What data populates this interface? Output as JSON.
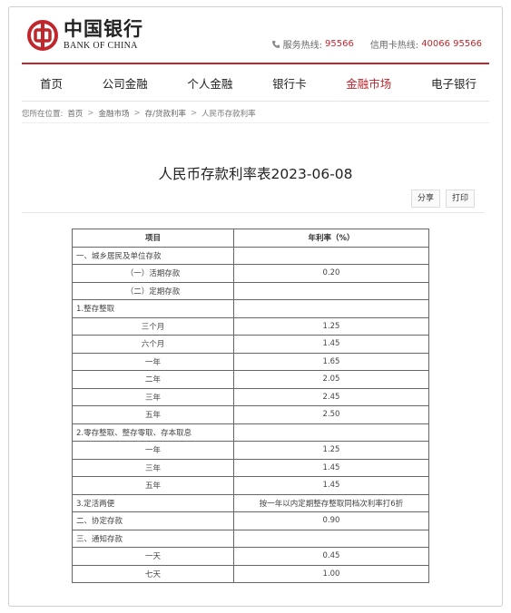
{
  "header": {
    "logo_cn": "中国银行",
    "logo_en": "BANK OF CHINA",
    "service_label": "服务热线:",
    "service_number": "95566",
    "card_label": "信用卡热线:",
    "card_number": "40066 95566",
    "accent_color": "#c0272d"
  },
  "nav": [
    "首页",
    "公司金融",
    "个人金融",
    "银行卡",
    "金融市场",
    "电子银行"
  ],
  "nav_active": "金融市场",
  "breadcrumb": {
    "prefix": "您所在位置:",
    "items": [
      "首页",
      "金融市场",
      "存/贷款利率",
      "人民币存款利率"
    ]
  },
  "page_title": "人民币存款利率表2023-06-08",
  "tools": {
    "share": "分享",
    "print": "打印"
  },
  "table": {
    "headers": [
      "项目",
      "年利率（%）"
    ],
    "rows": [
      {
        "item": "一、城乡居民及单位存款",
        "rate": "",
        "align": "left"
      },
      {
        "item": "（一）活期存款",
        "rate": "0.20",
        "align": "center"
      },
      {
        "item": "（二）定期存款",
        "rate": "",
        "align": "center"
      },
      {
        "item": "1.整存整取",
        "rate": "",
        "align": "left"
      },
      {
        "item": "三个月",
        "rate": "1.25",
        "align": "center"
      },
      {
        "item": "六个月",
        "rate": "1.45",
        "align": "center"
      },
      {
        "item": "一年",
        "rate": "1.65",
        "align": "center"
      },
      {
        "item": "二年",
        "rate": "2.05",
        "align": "center"
      },
      {
        "item": "三年",
        "rate": "2.45",
        "align": "center"
      },
      {
        "item": "五年",
        "rate": "2.50",
        "align": "center"
      },
      {
        "item": "2.零存整取、整存零取、存本取息",
        "rate": "",
        "align": "left"
      },
      {
        "item": "一年",
        "rate": "1.25",
        "align": "center"
      },
      {
        "item": "三年",
        "rate": "1.45",
        "align": "center"
      },
      {
        "item": "五年",
        "rate": "1.45",
        "align": "center"
      },
      {
        "item": "3.定活两便",
        "rate": "按一年以内定期整存整取同档次利率打6折",
        "align": "left"
      },
      {
        "item": "二、协定存款",
        "rate": "0.90",
        "align": "left"
      },
      {
        "item": "三、通知存款",
        "rate": "",
        "align": "left"
      },
      {
        "item": "一天",
        "rate": "0.45",
        "align": "center"
      },
      {
        "item": "七天",
        "rate": "1.00",
        "align": "center"
      }
    ]
  }
}
